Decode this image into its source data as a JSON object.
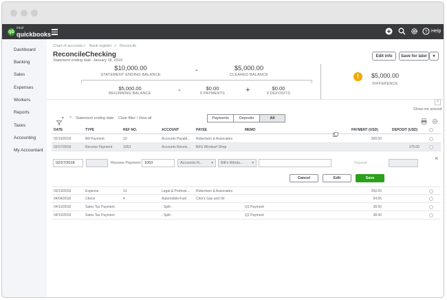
{
  "nav": {
    "items": [
      "Dashboard",
      "Banking",
      "Sales",
      "Expenses",
      "Workers",
      "Reports",
      "Taxes",
      "Accounting",
      "My Accountant"
    ]
  },
  "brand": {
    "logo_top": "intuit",
    "logo_main": "quickbooks",
    "logo_mark": "qb"
  },
  "topbar": {
    "help": "Help",
    "icons": [
      "plus-icon",
      "search-icon",
      "gear-icon",
      "help-icon"
    ]
  },
  "breadcrumb": [
    "Chart of accounts",
    "Bank register",
    "Reconcile"
  ],
  "breadcrumb_separator": ">",
  "page": {
    "title": "Reconcile",
    "account": "Checking",
    "statement_date": "Statement ending date: January 18, 2019",
    "edit_info": "Edit info",
    "save_for_later": "Save for later",
    "save_caret": "▾"
  },
  "balances": {
    "statement_ending": {
      "amount": "$10,000.00",
      "label": "STATEMENT ENDING BALANCE"
    },
    "minus1": "-",
    "cleared": {
      "amount": "$5,000.00",
      "label": "CLEARED BALANCE"
    },
    "beginning": {
      "amount": "$5,000.00",
      "label": "BEGINNING BALANCE"
    },
    "minus2": "-",
    "payments": {
      "amount": "$0.00",
      "label": "0 PAYMENTS"
    },
    "plus": "+",
    "deposits": {
      "amount": "$0.00",
      "label": "0 DEPOSITS"
    },
    "difference": {
      "amount": "$5,000.00",
      "label": "DIFFERENCE",
      "icon_glyph": "!"
    }
  },
  "toolbar": {
    "filter_caret": "▾",
    "clear_x": "×",
    "statement_filter": "Statement ending date",
    "clear_filter": "Clear filter / View all",
    "show_me_around": "Show me around",
    "collapse_glyph": "^",
    "tabs": [
      "Payments",
      "Deposits",
      "All"
    ],
    "active_tab": "All"
  },
  "table": {
    "columns": [
      "DATE",
      "TYPE",
      "REF NO.",
      "ACCOUNT",
      "PAYEE",
      "MEMO",
      "PAYMENT (USD)",
      "DEPOSIT (USD)"
    ],
    "rows_top": [
      [
        "02/19/2018",
        "Bill Payment",
        "10",
        "Accounts Payabl...",
        "Robertson & Associates",
        "",
        "300.00",
        ""
      ],
      [
        "02/27/2018",
        "Receive Payment",
        "1053",
        "Accounts Receiv...",
        "Bill's Windsurf Shop",
        "",
        "",
        "175.00"
      ]
    ],
    "rows_bottom": [
      [
        "03/13/2018",
        "Expense",
        "12",
        "Legal & Professi...",
        "Robertson & Associates",
        "",
        "250.00",
        ""
      ],
      [
        "04/04/2018",
        "Check",
        "4",
        "Automobile:Fuel",
        "Chin's Gas and Oil",
        "",
        "54.55",
        ""
      ],
      [
        "04/10/2018",
        "Sales Tax Payment",
        "",
        "- Split -",
        "",
        "Q1 Payment",
        "38.50",
        ""
      ],
      [
        "04/10/2018",
        "Sales Tax Payment",
        "",
        "- Split -",
        "",
        "Q1 Payment",
        "38.40",
        ""
      ]
    ]
  },
  "edit": {
    "date": "02/27/2018",
    "type": "Receive Payment",
    "ref": "1053",
    "account": "Accounts R...",
    "payee": "Bill's Winds...",
    "memo": "",
    "deposit_label": "Deposit",
    "caret": "▾",
    "close_glyph": "×",
    "cancel": "Cancel",
    "edit_btn": "Edit",
    "save": "Save"
  },
  "colors": {
    "brand_green": "#2ca01c",
    "topbar": "#393a3d",
    "warning": "#f2a900"
  }
}
